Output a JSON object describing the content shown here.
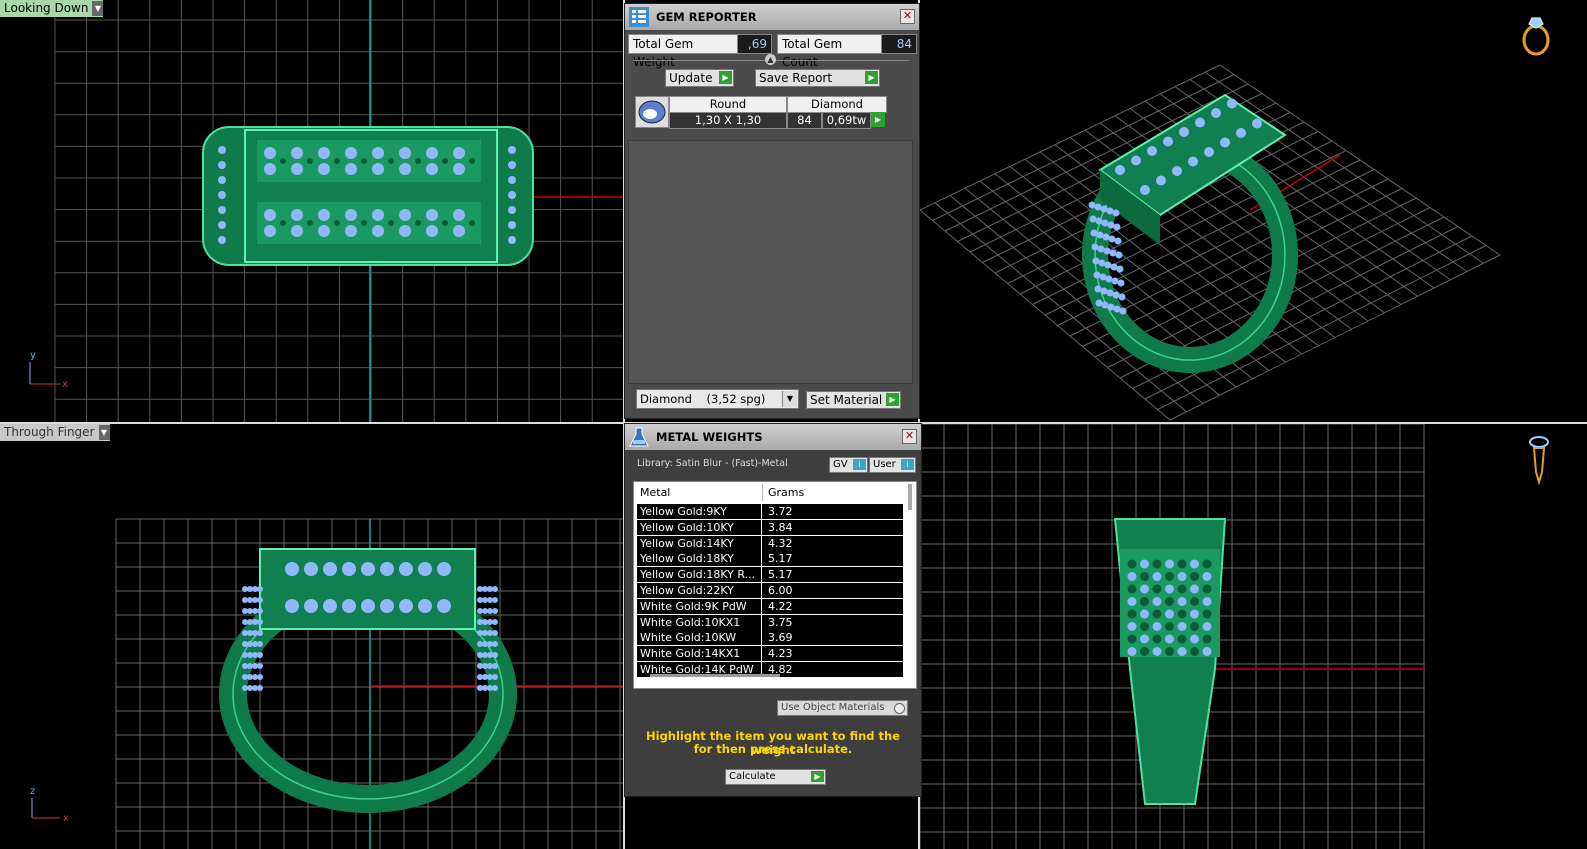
{
  "viewports": {
    "top_left_label": "Looking Down",
    "bottom_left_label": "Through Finger"
  },
  "axes": {
    "y": "y",
    "x": "x",
    "z": "z"
  },
  "gem_reporter": {
    "title": "GEM REPORTER",
    "total_weight_label": "Total Gem Weight",
    "total_weight_value": ",69",
    "total_count_label": "Total Gem Count",
    "total_count_value": "84",
    "update_label": "Update",
    "save_report_label": "Save Report",
    "table": {
      "headers": [
        "Round",
        "Diamond"
      ],
      "row": {
        "size": "1,30 X 1,30",
        "count": "84",
        "weight": "0,69tw"
      }
    },
    "material_select": "Diamond    (3,52 spg)",
    "set_material_label": "Set Material"
  },
  "metal_weights": {
    "title": "METAL WEIGHTS",
    "library": "Library: Satin Blur - (Fast)-Metal",
    "gv_label": "GV",
    "user_label": "User",
    "columns": [
      "Metal",
      "Grams"
    ],
    "rows": [
      {
        "metal": "Yellow Gold:9KY",
        "grams": "3.72"
      },
      {
        "metal": "Yellow Gold:10KY",
        "grams": "3.84"
      },
      {
        "metal": "Yellow Gold:14KY",
        "grams": "4.32"
      },
      {
        "metal": "Yellow Gold:18KY",
        "grams": "5.17"
      },
      {
        "metal": "Yellow Gold:18KY R...",
        "grams": "5.17"
      },
      {
        "metal": "Yellow Gold:22KY",
        "grams": "6.00"
      },
      {
        "metal": "White Gold:9K PdW",
        "grams": "4.22"
      },
      {
        "metal": "White Gold:10KX1",
        "grams": "3.75"
      },
      {
        "metal": "White Gold:10KW",
        "grams": "3.69"
      },
      {
        "metal": "White Gold:14KX1",
        "grams": "4.23"
      },
      {
        "metal": "White Gold:14K PdW",
        "grams": "4.82"
      }
    ],
    "use_object_materials": "Use Object Materials",
    "message_line1": "Highlight the item you want to find the weight",
    "message_line2": "for then press calculate.",
    "calculate_label": "Calculate"
  }
}
